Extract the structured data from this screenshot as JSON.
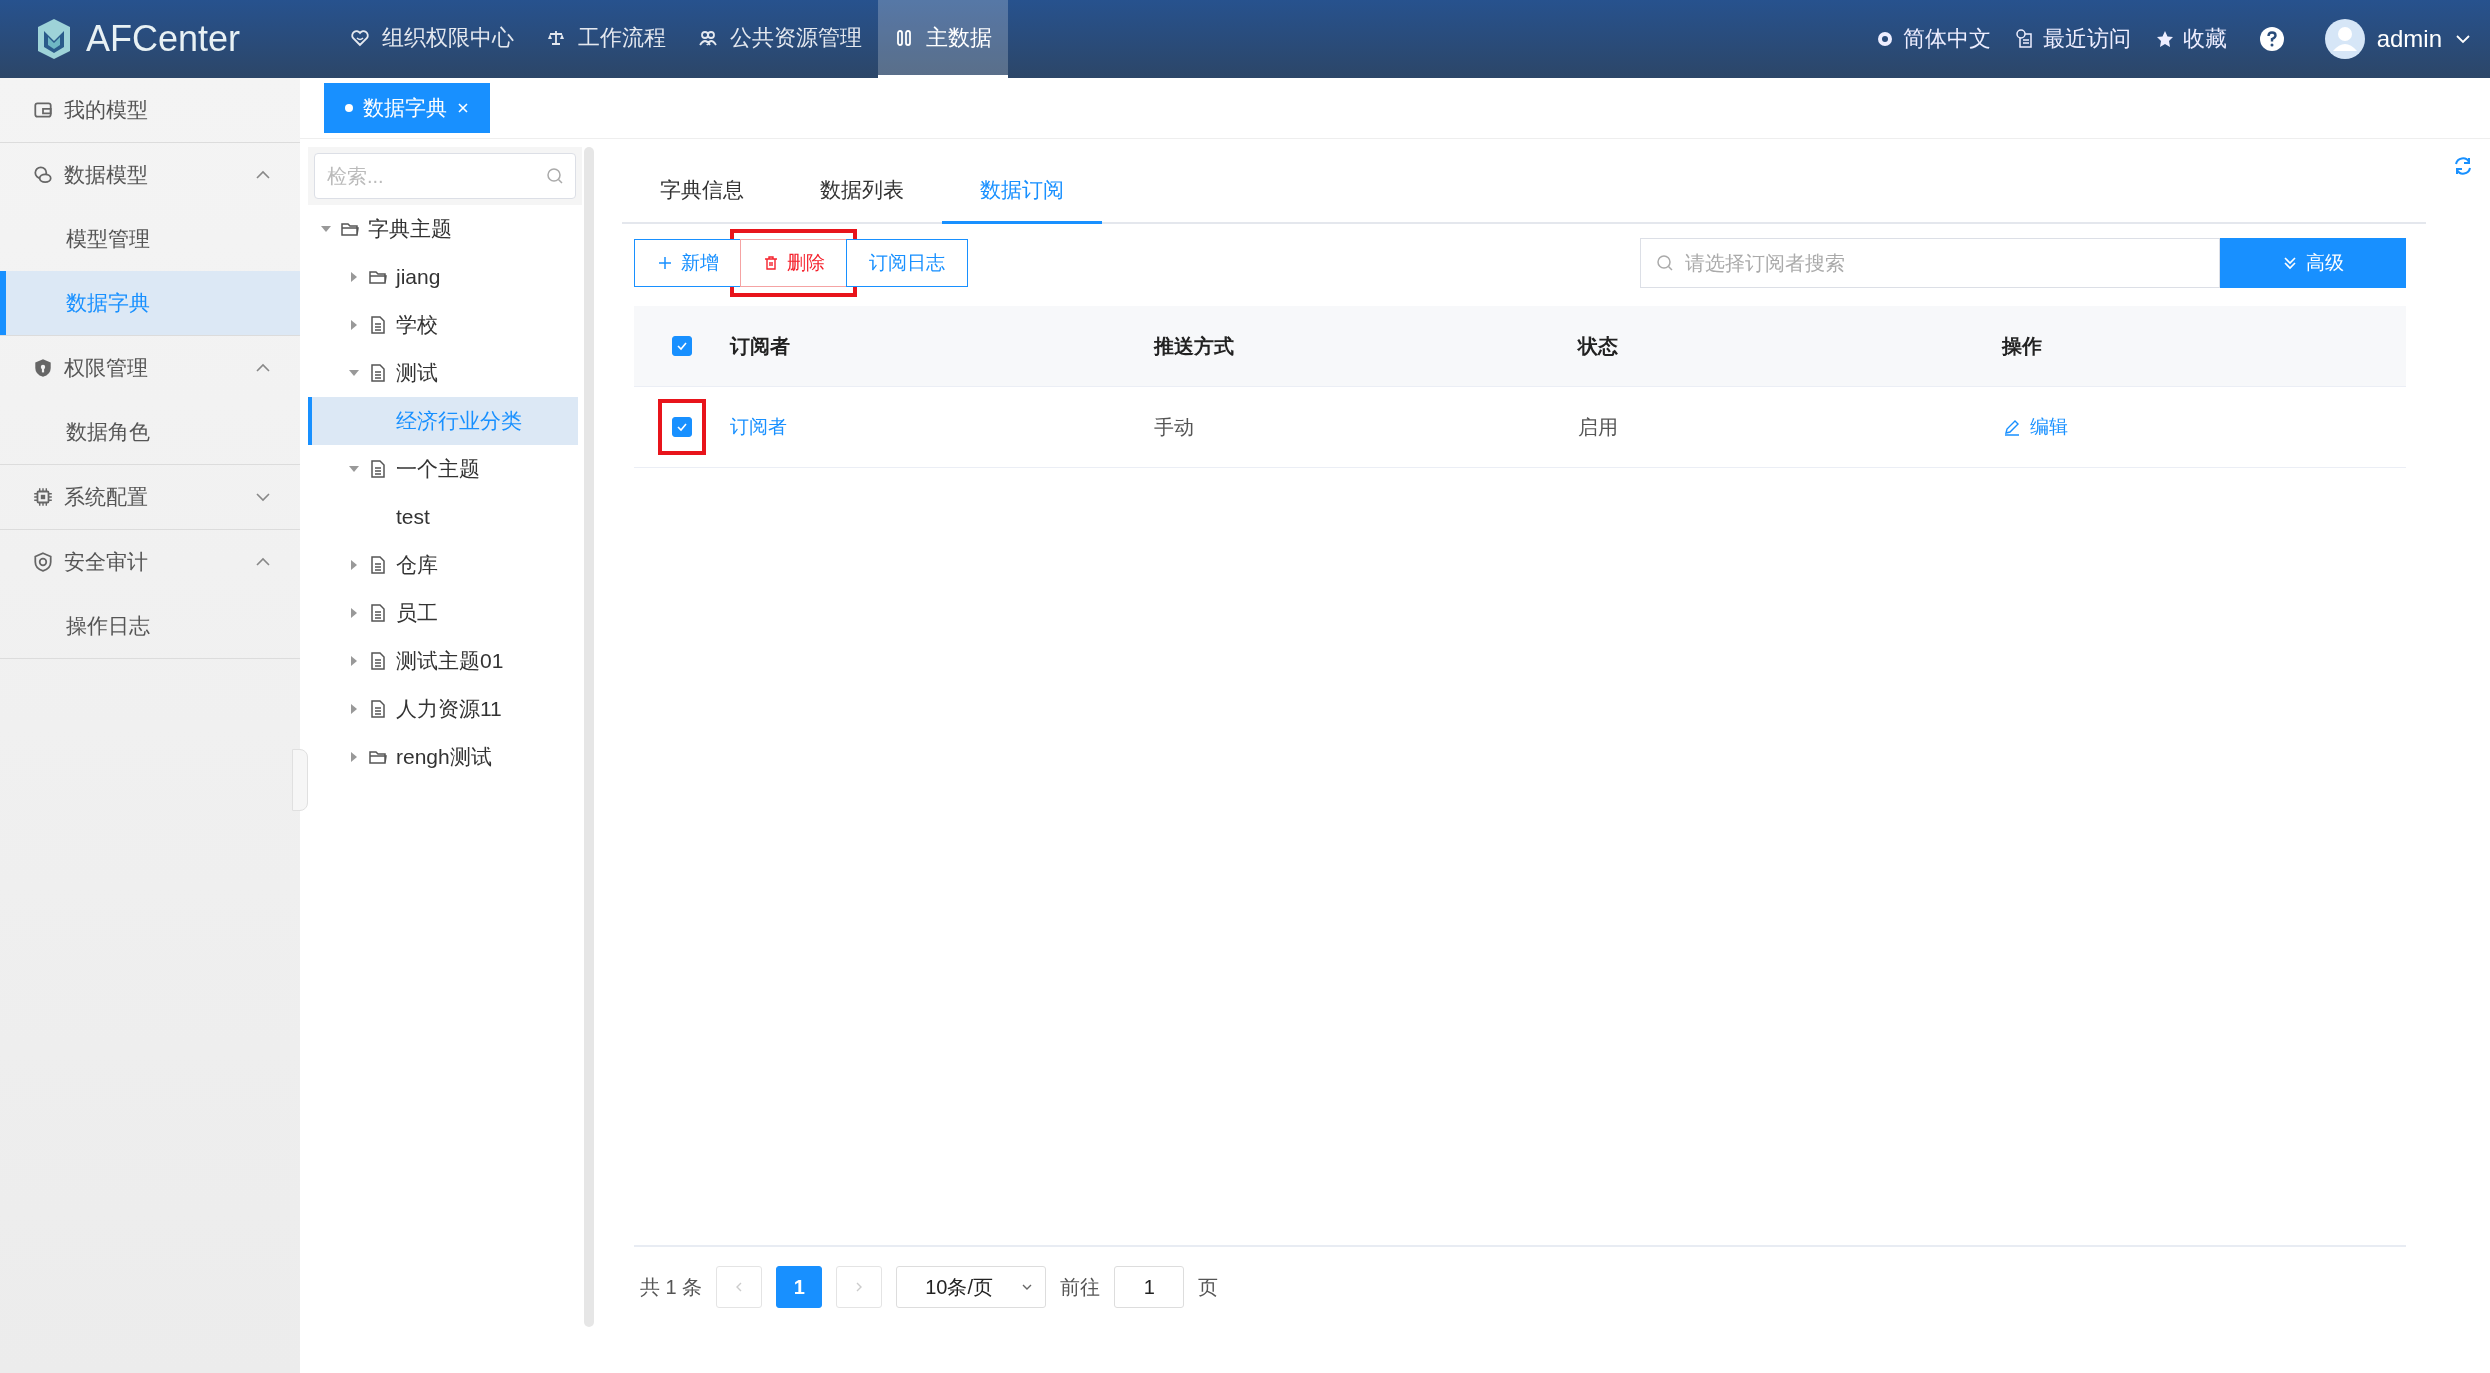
{
  "header": {
    "logo": "AFCenter",
    "nav": [
      {
        "label": "组织权限中心",
        "selected": false
      },
      {
        "label": "工作流程",
        "selected": false
      },
      {
        "label": "公共资源管理",
        "selected": false
      },
      {
        "label": "主数据",
        "selected": true
      }
    ],
    "actions": [
      {
        "label": "简体中文"
      },
      {
        "label": "最近访问"
      },
      {
        "label": "收藏"
      }
    ],
    "user": "admin"
  },
  "sidebar": {
    "items": [
      {
        "label": "我的模型"
      },
      {
        "label": "数据模型",
        "expanded": true,
        "children": [
          {
            "label": "模型管理",
            "selected": false
          },
          {
            "label": "数据字典",
            "selected": true
          }
        ]
      },
      {
        "label": "权限管理",
        "expanded": true,
        "children": [
          {
            "label": "数据角色",
            "selected": false
          }
        ]
      },
      {
        "label": "系统配置",
        "expanded": false
      },
      {
        "label": "安全审计",
        "expanded": true,
        "children": [
          {
            "label": "操作日志",
            "selected": false
          }
        ]
      }
    ]
  },
  "open_tabs": [
    {
      "label": "数据字典",
      "selected": true
    }
  ],
  "tree": {
    "search": {
      "placeholder": "检索..."
    },
    "nodes": [
      {
        "label": "字典主题",
        "kind": "folder",
        "expanded": true,
        "selected": false,
        "children": [
          {
            "label": "jiang",
            "kind": "folder",
            "expanded": false,
            "selected": false
          },
          {
            "label": "学校",
            "kind": "file",
            "expanded": false,
            "selected": false
          },
          {
            "label": "测试",
            "kind": "file",
            "expanded": true,
            "selected": false,
            "children": [
              {
                "label": "经济行业分类",
                "selected": true
              }
            ]
          },
          {
            "label": "一个主题",
            "kind": "file",
            "expanded": true,
            "selected": false,
            "children": [
              {
                "label": "test",
                "selected": false
              }
            ]
          },
          {
            "label": "仓库",
            "kind": "file",
            "expanded": false,
            "selected": false
          },
          {
            "label": "员工",
            "kind": "file",
            "expanded": false,
            "selected": false
          },
          {
            "label": "测试主题01",
            "kind": "file",
            "expanded": false,
            "selected": false
          },
          {
            "label": "人力资源11",
            "kind": "file",
            "expanded": false,
            "selected": false
          },
          {
            "label": "rengh测试",
            "kind": "folder",
            "expanded": false,
            "selected": false
          }
        ]
      }
    ]
  },
  "tabs": [
    {
      "label": "字典信息",
      "selected": false
    },
    {
      "label": "数据列表",
      "selected": false
    },
    {
      "label": "数据订阅",
      "selected": true
    }
  ],
  "toolbar": {
    "buttons": [
      {
        "label": "新增",
        "kind": "add",
        "highlighted": false
      },
      {
        "label": "删除",
        "kind": "delete",
        "highlighted": true
      },
      {
        "label": "订阅日志",
        "kind": "plain",
        "highlighted": false
      }
    ],
    "search": {
      "placeholder": "请选择订阅者搜索"
    },
    "advanced": "高级"
  },
  "table": {
    "all_checked": true,
    "columns": [
      "订阅者",
      "推送方式",
      "状态",
      "操作"
    ],
    "rows": [
      {
        "checked": true,
        "highlighted": true,
        "subscriber": "订阅者",
        "push_mode": "手动",
        "status": "启用",
        "action": "编辑"
      }
    ]
  },
  "pagination": {
    "total": "共 1 条",
    "pages": [
      {
        "label": "1",
        "selected": true
      }
    ],
    "page_size": "10条/页",
    "goto_label": "前往",
    "goto_value": "1",
    "goto_suffix": "页"
  }
}
